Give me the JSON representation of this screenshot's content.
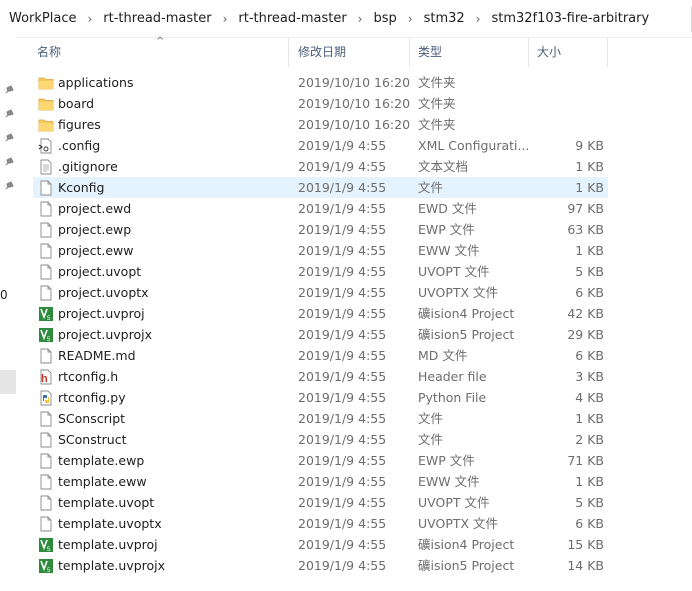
{
  "breadcrumb": [
    "WorkPlace",
    "rt-thread-master",
    "rt-thread-master",
    "bsp",
    "stm32",
    "stm32f103-fire-arbitrary"
  ],
  "nav": {
    "partial_char": "0"
  },
  "columns": {
    "name": "名称",
    "date": "修改日期",
    "type": "类型",
    "size": "大小"
  },
  "rows": [
    {
      "name": "applications",
      "date": "2019/10/10 16:20",
      "type": "文件夹",
      "size": "",
      "icon": "folder-icon"
    },
    {
      "name": "board",
      "date": "2019/10/10 16:20",
      "type": "文件夹",
      "size": "",
      "icon": "folder-icon"
    },
    {
      "name": "figures",
      "date": "2019/10/10 16:20",
      "type": "文件夹",
      "size": "",
      "icon": "folder-icon"
    },
    {
      "name": ".config",
      "date": "2019/1/9 4:55",
      "type": "XML Configurati...",
      "size": "9 KB",
      "icon": "xml-config-icon"
    },
    {
      "name": ".gitignore",
      "date": "2019/1/9 4:55",
      "type": "文本文档",
      "size": "1 KB",
      "icon": "text-document-icon"
    },
    {
      "name": "Kconfig",
      "date": "2019/1/9 4:55",
      "type": "文件",
      "size": "1 KB",
      "icon": "file-icon",
      "selected": true
    },
    {
      "name": "project.ewd",
      "date": "2019/1/9 4:55",
      "type": "EWD 文件",
      "size": "97 KB",
      "icon": "file-icon"
    },
    {
      "name": "project.ewp",
      "date": "2019/1/9 4:55",
      "type": "EWP 文件",
      "size": "63 KB",
      "icon": "file-icon"
    },
    {
      "name": "project.eww",
      "date": "2019/1/9 4:55",
      "type": "EWW 文件",
      "size": "1 KB",
      "icon": "file-icon"
    },
    {
      "name": "project.uvopt",
      "date": "2019/1/9 4:55",
      "type": "UVOPT 文件",
      "size": "5 KB",
      "icon": "file-icon"
    },
    {
      "name": "project.uvoptx",
      "date": "2019/1/9 4:55",
      "type": "UVOPTX 文件",
      "size": "6 KB",
      "icon": "file-icon"
    },
    {
      "name": "project.uvproj",
      "date": "2019/1/9 4:55",
      "type": "礦ision4 Project",
      "size": "42 KB",
      "icon": "keil-project-icon"
    },
    {
      "name": "project.uvprojx",
      "date": "2019/1/9 4:55",
      "type": "礦ision5 Project",
      "size": "29 KB",
      "icon": "keil-project-icon"
    },
    {
      "name": "README.md",
      "date": "2019/1/9 4:55",
      "type": "MD 文件",
      "size": "6 KB",
      "icon": "file-icon"
    },
    {
      "name": "rtconfig.h",
      "date": "2019/1/9 4:55",
      "type": "Header file",
      "size": "3 KB",
      "icon": "header-file-icon"
    },
    {
      "name": "rtconfig.py",
      "date": "2019/1/9 4:55",
      "type": "Python File",
      "size": "4 KB",
      "icon": "python-file-icon"
    },
    {
      "name": "SConscript",
      "date": "2019/1/9 4:55",
      "type": "文件",
      "size": "1 KB",
      "icon": "file-icon"
    },
    {
      "name": "SConstruct",
      "date": "2019/1/9 4:55",
      "type": "文件",
      "size": "2 KB",
      "icon": "file-icon"
    },
    {
      "name": "template.ewp",
      "date": "2019/1/9 4:55",
      "type": "EWP 文件",
      "size": "71 KB",
      "icon": "file-icon"
    },
    {
      "name": "template.eww",
      "date": "2019/1/9 4:55",
      "type": "EWW 文件",
      "size": "1 KB",
      "icon": "file-icon"
    },
    {
      "name": "template.uvopt",
      "date": "2019/1/9 4:55",
      "type": "UVOPT 文件",
      "size": "5 KB",
      "icon": "file-icon"
    },
    {
      "name": "template.uvoptx",
      "date": "2019/1/9 4:55",
      "type": "UVOPTX 文件",
      "size": "6 KB",
      "icon": "file-icon"
    },
    {
      "name": "template.uvproj",
      "date": "2019/1/9 4:55",
      "type": "礦ision4 Project",
      "size": "15 KB",
      "icon": "keil-project-icon"
    },
    {
      "name": "template.uvprojx",
      "date": "2019/1/9 4:55",
      "type": "礦ision5 Project",
      "size": "14 KB",
      "icon": "keil-project-icon"
    }
  ],
  "colors": {
    "selection": "#e5f3ff",
    "folder": "#f8c95a",
    "header_text": "#4c607a",
    "keil_green": "#2e8b3c",
    "header_red": "#c0392b"
  }
}
